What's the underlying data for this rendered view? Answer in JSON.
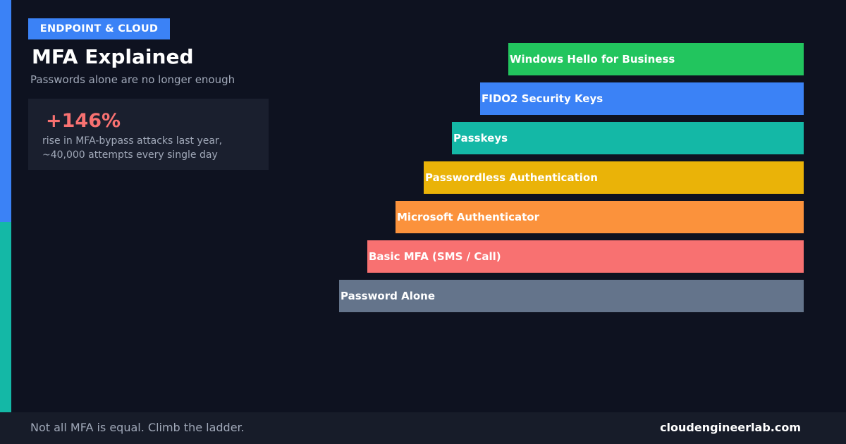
{
  "header": {
    "badge": "ENDPOINT & CLOUD",
    "title": "MFA Explained",
    "subtitle": "Passwords alone are no longer enough"
  },
  "stat": {
    "value": "+146%",
    "line1": "rise in MFA-bypass attacks last year,",
    "line2": "~40,000 attempts every single day"
  },
  "ladder": {
    "rungs": [
      {
        "label": "Windows Hello for Business",
        "color": "#22c55e"
      },
      {
        "label": "FIDO2 Security Keys",
        "color": "#3b82f6"
      },
      {
        "label": "Passkeys",
        "color": "#14b8a6"
      },
      {
        "label": "Passwordless Authentication",
        "color": "#eab308"
      },
      {
        "label": "Microsoft Authenticator",
        "color": "#fb923c"
      },
      {
        "label": "Basic MFA (SMS / Call)",
        "color": "#f87171"
      },
      {
        "label": "Password Alone",
        "color": "#64748b"
      }
    ]
  },
  "footer": {
    "tagline": "Not all MFA is equal. Climb the ladder.",
    "site": "cloudengineerlab.com"
  },
  "colors": {
    "background": "#0e1220",
    "accent_blue": "#3b82f6",
    "accent_teal": "#14b8a6",
    "stat_red": "#f87171"
  }
}
